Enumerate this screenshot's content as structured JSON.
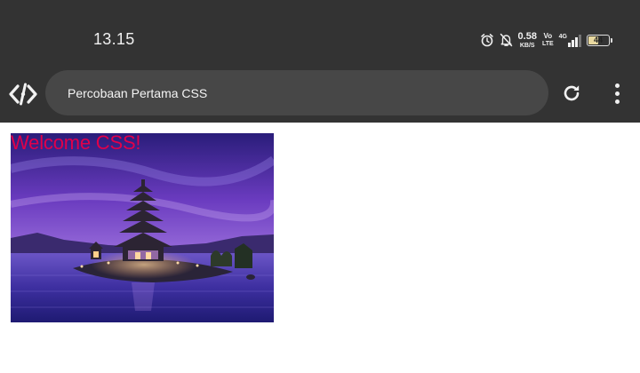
{
  "status_bar": {
    "time": "13.15",
    "net_speed_value": "0.58",
    "net_speed_unit": "KB/S",
    "volte_top": "Vo",
    "volte_bottom": "LTE",
    "network_type": "4G",
    "battery_level": "44"
  },
  "browser": {
    "address_text": "Percobaan Pertama CSS"
  },
  "page": {
    "heading": "Welcome CSS!"
  },
  "colors": {
    "chrome_background": "#333333",
    "address_bar_background": "#474747",
    "heading_color": "#e0004a"
  },
  "icons": [
    "alarm-icon",
    "bell-off-icon",
    "signal-icon",
    "battery-icon",
    "app-logo-icon",
    "reload-icon",
    "more-vert-icon"
  ]
}
